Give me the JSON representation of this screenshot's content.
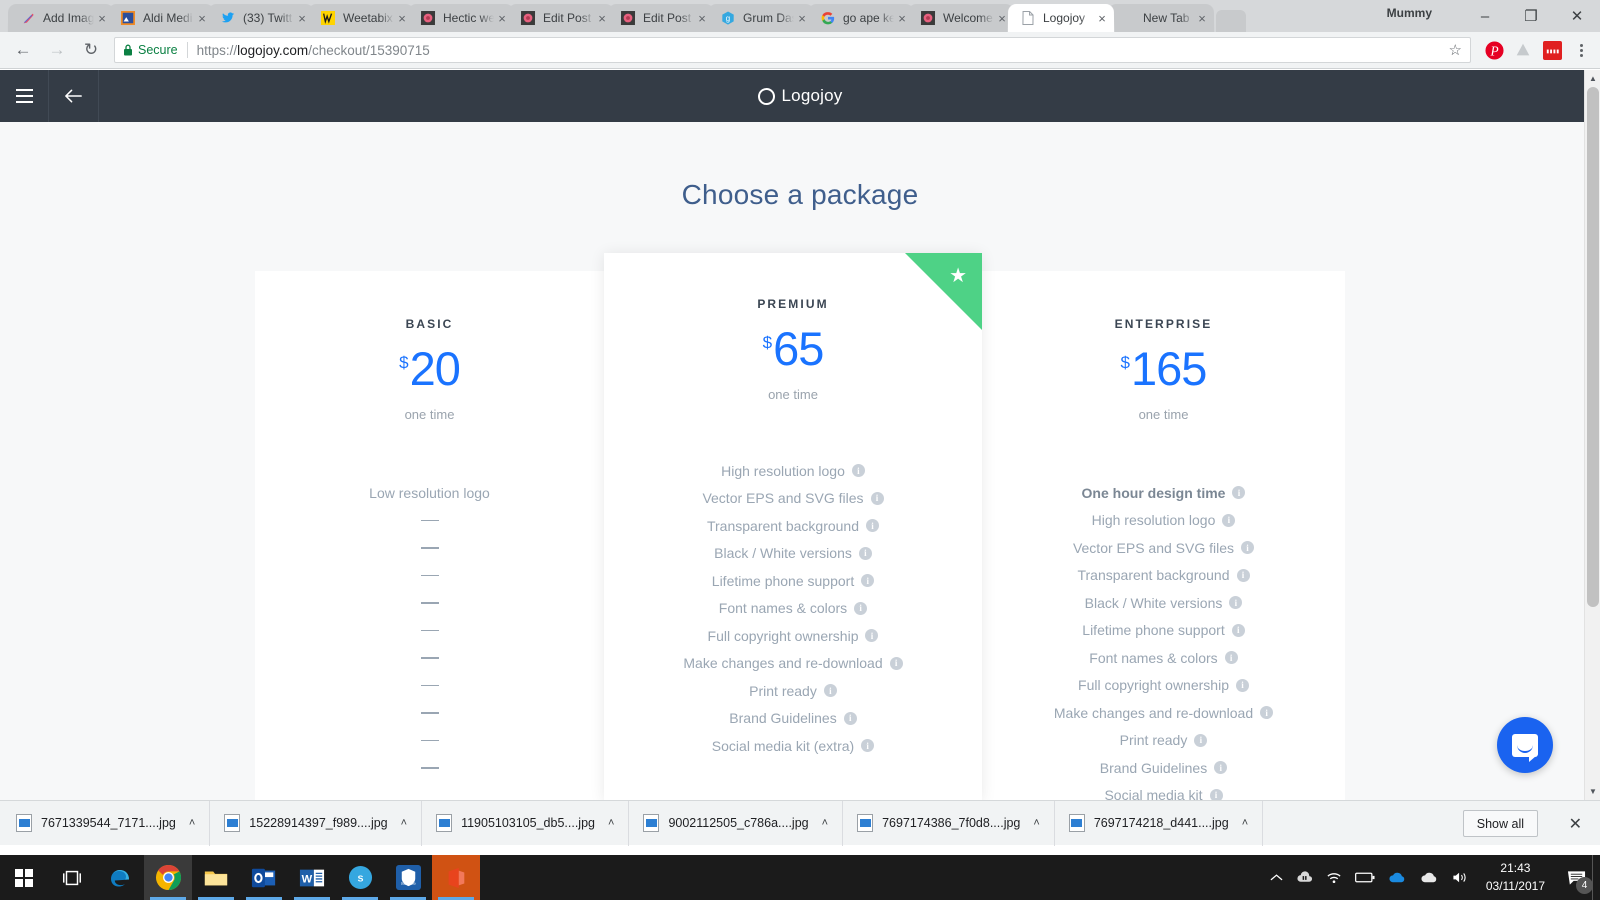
{
  "browser": {
    "tabs": [
      {
        "title": "Add Imag",
        "favicon": "feather-icon",
        "active": false
      },
      {
        "title": "Aldi Medi",
        "favicon": "image-icon",
        "active": false
      },
      {
        "title": "(33) Twitt",
        "favicon": "twitter-icon",
        "active": false
      },
      {
        "title": "Weetabix",
        "favicon": "weetabix-icon",
        "active": false
      },
      {
        "title": "Hectic we",
        "favicon": "wordpress-icon",
        "active": false
      },
      {
        "title": "Edit Post",
        "favicon": "wordpress-icon",
        "active": false
      },
      {
        "title": "Edit Post",
        "favicon": "wordpress-icon",
        "active": false
      },
      {
        "title": "Grum Das",
        "favicon": "grum-icon",
        "active": false
      },
      {
        "title": "go ape ke",
        "favicon": "google-icon",
        "active": false
      },
      {
        "title": "Welcome",
        "favicon": "wordpress-icon",
        "active": false
      },
      {
        "title": "Logojoy",
        "favicon": "page-icon",
        "active": true
      },
      {
        "title": "New Tab",
        "favicon": "none",
        "active": false
      }
    ],
    "tab_close_label": "×",
    "profile_name": "Mummy",
    "window_controls": {
      "minimize": "–",
      "maximize": "❐",
      "close": "✕"
    },
    "toolbar": {
      "back": "←",
      "forward": "→",
      "reload": "↻",
      "secure_label": "Secure",
      "url_scheme": "https://",
      "url_host": "logojoy.com",
      "url_path": "/checkout/15390715",
      "bookmark_star": "☆",
      "extensions": [
        "pinterest-icon",
        "drive-icon",
        "adblock-icon"
      ],
      "menu": "chrome-menu-icon"
    }
  },
  "site": {
    "header": {
      "menu_icon": "hamburger-icon",
      "back_icon": "back-arrow-icon",
      "brand": "Logojoy"
    },
    "page_title": "Choose a package",
    "ribbon_star": "★",
    "packages": [
      {
        "id": "basic",
        "name": "BASIC",
        "currency": "$",
        "price": "20",
        "billing": "one time",
        "featured": false,
        "features": [
          {
            "label": "Low resolution logo",
            "info": false,
            "bold": false,
            "dash": false
          },
          {
            "label": "",
            "info": false,
            "bold": false,
            "dash": true
          },
          {
            "label": "",
            "info": false,
            "bold": false,
            "dash": true
          },
          {
            "label": "",
            "info": false,
            "bold": false,
            "dash": true
          },
          {
            "label": "",
            "info": false,
            "bold": false,
            "dash": true
          },
          {
            "label": "",
            "info": false,
            "bold": false,
            "dash": true
          },
          {
            "label": "",
            "info": false,
            "bold": false,
            "dash": true
          },
          {
            "label": "",
            "info": false,
            "bold": false,
            "dash": true
          },
          {
            "label": "",
            "info": false,
            "bold": false,
            "dash": true
          },
          {
            "label": "",
            "info": false,
            "bold": false,
            "dash": true
          },
          {
            "label": "",
            "info": false,
            "bold": false,
            "dash": true
          }
        ]
      },
      {
        "id": "premium",
        "name": "PREMIUM",
        "currency": "$",
        "price": "65",
        "billing": "one time",
        "featured": true,
        "features": [
          {
            "label": "High resolution logo",
            "info": true,
            "bold": false,
            "dash": false
          },
          {
            "label": "Vector EPS and SVG files",
            "info": true,
            "bold": false,
            "dash": false
          },
          {
            "label": "Transparent background",
            "info": true,
            "bold": false,
            "dash": false
          },
          {
            "label": "Black / White versions",
            "info": true,
            "bold": false,
            "dash": false
          },
          {
            "label": "Lifetime phone support",
            "info": true,
            "bold": false,
            "dash": false
          },
          {
            "label": "Font names & colors",
            "info": true,
            "bold": false,
            "dash": false
          },
          {
            "label": "Full copyright ownership",
            "info": true,
            "bold": false,
            "dash": false
          },
          {
            "label": "Make changes and re-download",
            "info": true,
            "bold": false,
            "dash": false
          },
          {
            "label": "Print ready",
            "info": true,
            "bold": false,
            "dash": false
          },
          {
            "label": "Brand Guidelines",
            "info": true,
            "bold": false,
            "dash": false
          },
          {
            "label": "Social media kit (extra)",
            "info": true,
            "bold": false,
            "dash": false
          }
        ]
      },
      {
        "id": "enterprise",
        "name": "ENTERPRISE",
        "currency": "$",
        "price": "165",
        "billing": "one time",
        "featured": false,
        "features": [
          {
            "label": "One hour design time",
            "info": true,
            "bold": true,
            "dash": false
          },
          {
            "label": "High resolution logo",
            "info": true,
            "bold": false,
            "dash": false
          },
          {
            "label": "Vector EPS and SVG files",
            "info": true,
            "bold": false,
            "dash": false
          },
          {
            "label": "Transparent background",
            "info": true,
            "bold": false,
            "dash": false
          },
          {
            "label": "Black / White versions",
            "info": true,
            "bold": false,
            "dash": false
          },
          {
            "label": "Lifetime phone support",
            "info": true,
            "bold": false,
            "dash": false
          },
          {
            "label": "Font names & colors",
            "info": true,
            "bold": false,
            "dash": false
          },
          {
            "label": "Full copyright ownership",
            "info": true,
            "bold": false,
            "dash": false
          },
          {
            "label": "Make changes and re-download",
            "info": true,
            "bold": false,
            "dash": false
          },
          {
            "label": "Print ready",
            "info": true,
            "bold": false,
            "dash": false
          },
          {
            "label": "Brand Guidelines",
            "info": true,
            "bold": false,
            "dash": false
          },
          {
            "label": "Social media kit",
            "info": true,
            "bold": false,
            "dash": false
          }
        ]
      }
    ],
    "chat_widget": "intercom-chat-icon",
    "colors": {
      "accent_blue": "#1a73ff",
      "ribbon_green": "#4ed286",
      "header_dark": "#343c46",
      "title_blue": "#3f5e8c"
    }
  },
  "downloads": {
    "items": [
      {
        "name": "7671339544_7171....jpg"
      },
      {
        "name": "15228914397_f989....jpg"
      },
      {
        "name": "11905103105_db5....jpg"
      },
      {
        "name": "9002112505_c786a....jpg"
      },
      {
        "name": "7697174386_7f0d8....jpg"
      },
      {
        "name": "7697174218_d441....jpg"
      }
    ],
    "caret": "˄",
    "show_all_label": "Show all",
    "close_label": "✕"
  },
  "taskbar": {
    "start": "windows-start-icon",
    "apps": [
      {
        "name": "task-view-icon"
      },
      {
        "name": "edge-icon"
      },
      {
        "name": "chrome-icon"
      },
      {
        "name": "file-explorer-icon"
      },
      {
        "name": "outlook-icon"
      },
      {
        "name": "word-icon"
      },
      {
        "name": "skype-icon"
      },
      {
        "name": "mcafee-icon"
      },
      {
        "name": "office-icon"
      }
    ],
    "tray": [
      "show-hidden-icons",
      "onedrive-dark-icon",
      "wifi-icon",
      "battery-icon",
      "onedrive-blue-icon",
      "cloud-icon",
      "volume-icon"
    ],
    "time": "21:43",
    "date": "03/11/2017",
    "notification_count": "4"
  }
}
